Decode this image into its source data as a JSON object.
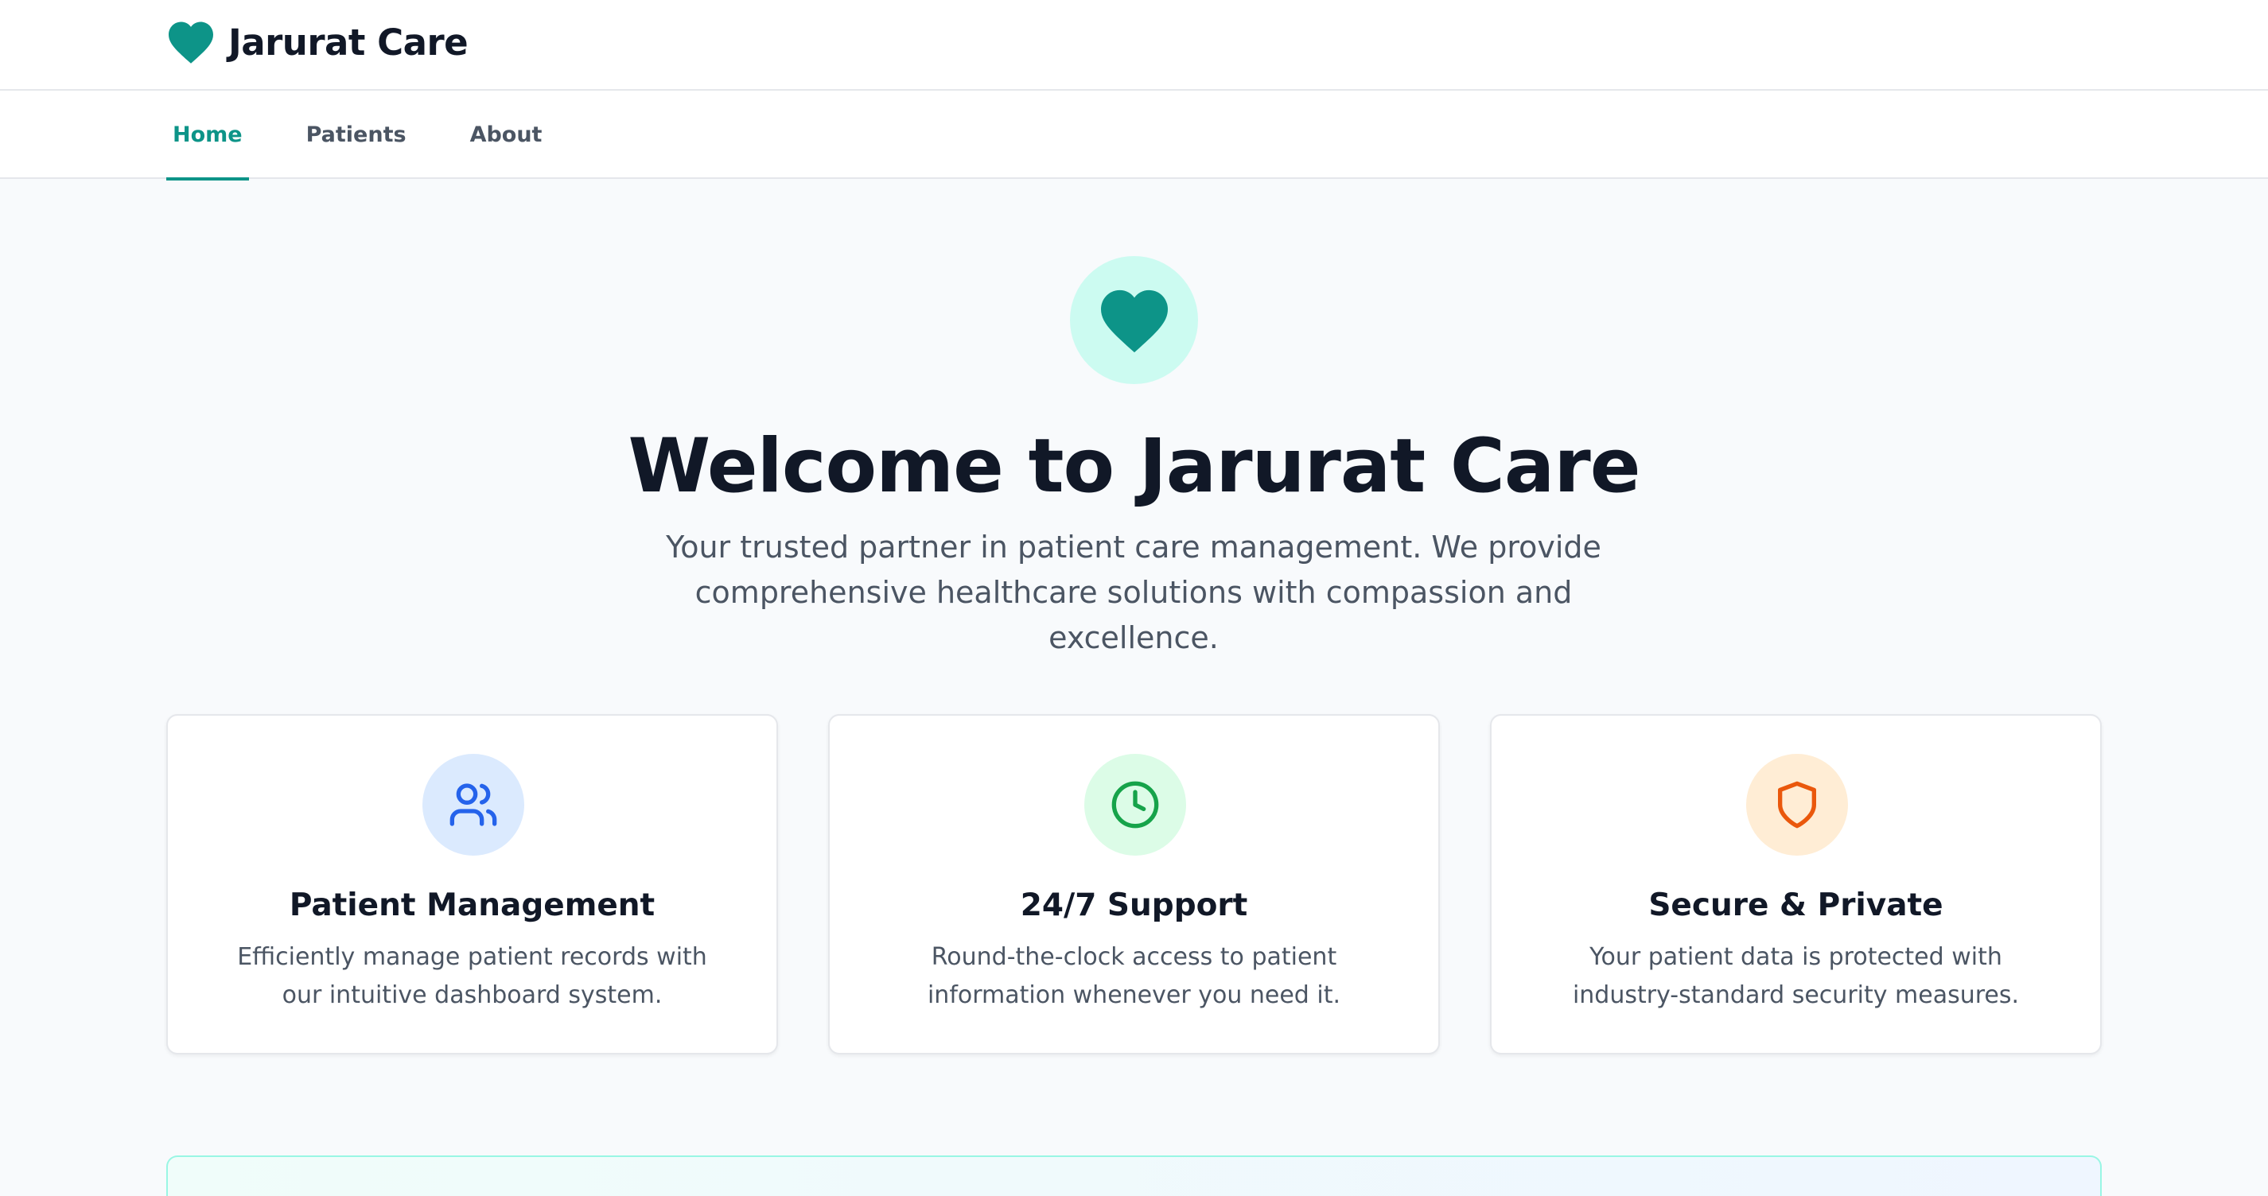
{
  "header": {
    "brand_name": "Jarurat Care",
    "brand_icon": "heart-icon",
    "brand_color": "#0d9488"
  },
  "nav": {
    "tabs": [
      {
        "label": "Home",
        "active": true
      },
      {
        "label": "Patients",
        "active": false
      },
      {
        "label": "About",
        "active": false
      }
    ],
    "active_color": "#0d9488"
  },
  "hero": {
    "icon": "heart-icon",
    "title": "Welcome to Jarurat Care",
    "subtitle": "Your trusted partner in patient care management. We provide comprehensive healthcare solutions with compassion and excellence."
  },
  "features": [
    {
      "icon": "users-icon",
      "icon_color": "#2563eb",
      "icon_bg": "#dbeafe",
      "title": "Patient Management",
      "text": "Efficiently manage patient records with our intuitive dashboard system."
    },
    {
      "icon": "clock-icon",
      "icon_color": "#16a34a",
      "icon_bg": "#dcfce7",
      "title": "24/7 Support",
      "text": "Round-the-clock access to patient information whenever you need it."
    },
    {
      "icon": "shield-icon",
      "icon_color": "#ea580c",
      "icon_bg": "#ffedd5",
      "title": "Secure & Private",
      "text": "Your patient data is protected with industry-standard security measures."
    }
  ]
}
